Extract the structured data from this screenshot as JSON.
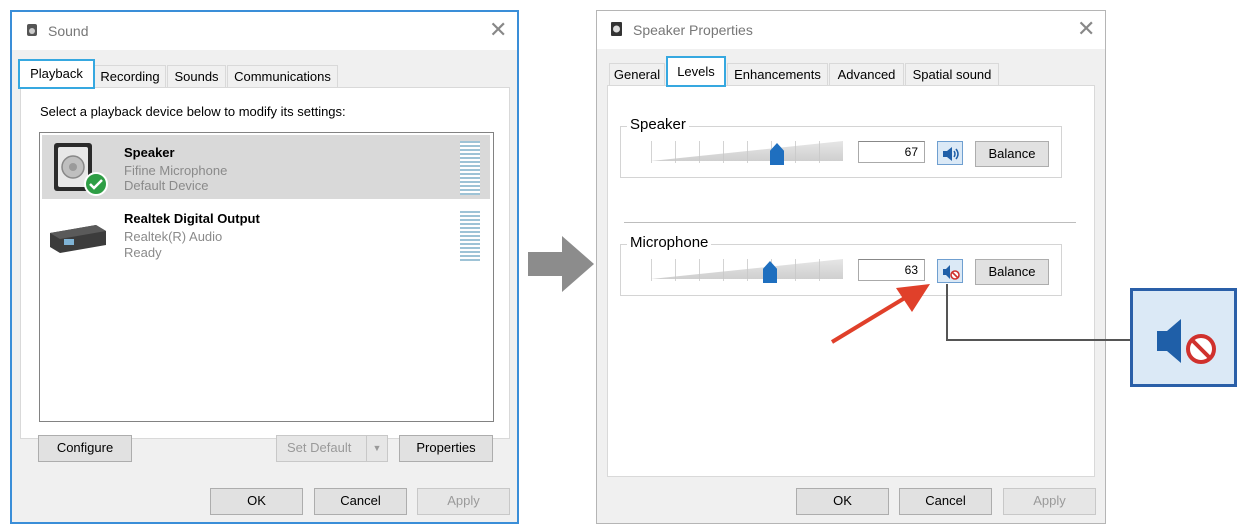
{
  "colors": {
    "accent": "#36a8e0",
    "arrow_red": "#e0402a",
    "speaker_blue": "#1f5fa8"
  },
  "sound_dialog": {
    "title": "Sound",
    "tabs": [
      {
        "label": "Playback",
        "selected": true
      },
      {
        "label": "Recording",
        "selected": false
      },
      {
        "label": "Sounds",
        "selected": false
      },
      {
        "label": "Communications",
        "selected": false
      }
    ],
    "instruction": "Select a playback device below to modify its settings:",
    "devices": [
      {
        "name": "Speaker",
        "line1": "Fifine Microphone",
        "line2": "Default Device",
        "icon": "speaker-icon",
        "selected": true,
        "default": true
      },
      {
        "name": "Realtek Digital Output",
        "line1": "Realtek(R) Audio",
        "line2": "Ready",
        "icon": "digital-output-icon",
        "selected": false,
        "default": false
      }
    ],
    "buttons": {
      "configure": "Configure",
      "set_default": "Set Default",
      "properties": "Properties",
      "ok": "OK",
      "cancel": "Cancel",
      "apply": "Apply"
    }
  },
  "speaker_properties": {
    "title": "Speaker Properties",
    "tabs": [
      {
        "label": "General",
        "selected": false
      },
      {
        "label": "Levels",
        "selected": true
      },
      {
        "label": "Enhancements",
        "selected": false
      },
      {
        "label": "Advanced",
        "selected": false
      },
      {
        "label": "Spatial sound",
        "selected": false
      }
    ],
    "levels": [
      {
        "label": "Speaker",
        "value": "67",
        "level": 67,
        "muted": false,
        "balance": "Balance"
      },
      {
        "label": "Microphone",
        "value": "63",
        "level": 63,
        "muted": true,
        "balance": "Balance"
      }
    ],
    "buttons": {
      "ok": "OK",
      "cancel": "Cancel",
      "apply": "Apply"
    }
  },
  "callout": {
    "icon": "speaker-muted-icon"
  }
}
